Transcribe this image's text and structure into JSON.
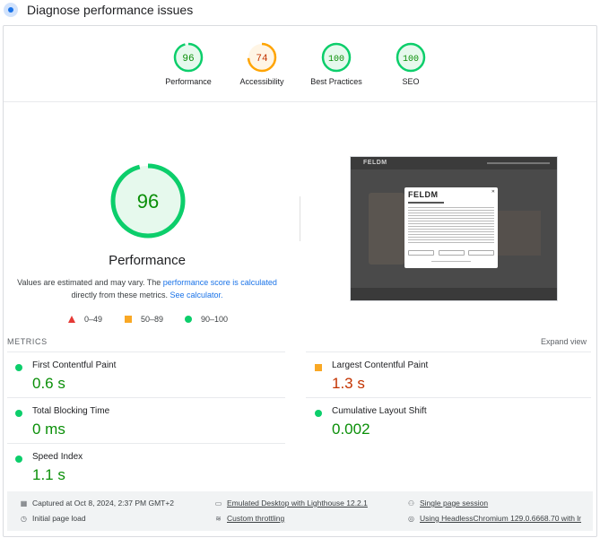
{
  "header": {
    "title": "Diagnose performance issues",
    "icon": "lighthouse-icon"
  },
  "gauges": [
    {
      "score": "96",
      "label": "Performance",
      "color": "#0cce6b",
      "fraction": 0.96
    },
    {
      "score": "74",
      "label": "Accessibility",
      "color": "#ffa400",
      "fraction": 0.74
    },
    {
      "score": "100",
      "label": "Best Practices",
      "color": "#0cce6b",
      "fraction": 1.0
    },
    {
      "score": "100",
      "label": "SEO",
      "color": "#0cce6b",
      "fraction": 1.0
    }
  ],
  "main": {
    "score": "96",
    "title": "Performance",
    "desc_prefix": "Values are estimated and may vary. The ",
    "desc_link1": "performance score is calculated",
    "desc_mid": "directly from these metrics. ",
    "desc_link2": "See calculator."
  },
  "legend": {
    "fail": "0–49",
    "average": "50–89",
    "pass": "90–100"
  },
  "screenshot": {
    "site_logo": "FELDM",
    "modal_logo": "FELDM",
    "close": "✕"
  },
  "metrics": {
    "heading": "METRICS",
    "expand": "Expand view",
    "items": [
      {
        "name": "First Contentful Paint",
        "value": "0.6 s",
        "status": "pass"
      },
      {
        "name": "Largest Contentful Paint",
        "value": "1.3 s",
        "status": "average"
      },
      {
        "name": "Total Blocking Time",
        "value": "0 ms",
        "status": "pass"
      },
      {
        "name": "Cumulative Layout Shift",
        "value": "0.002",
        "status": "pass"
      },
      {
        "name": "Speed Index",
        "value": "1.1 s",
        "status": "pass"
      }
    ]
  },
  "footer": {
    "captured": "Captured at Oct 8, 2024, 2:37 PM GMT+2",
    "load": "Initial page load",
    "emulated": "Emulated Desktop with Lighthouse 12.2.1",
    "throttling": "Custom throttling",
    "session": "Single page session",
    "browser": "Using HeadlessChromium 129.0.6668.70 with lr"
  },
  "colors": {
    "pass": "#0cce6b",
    "average": "#ffa400",
    "fail": "#ff4e42",
    "link": "#1a73e8"
  }
}
